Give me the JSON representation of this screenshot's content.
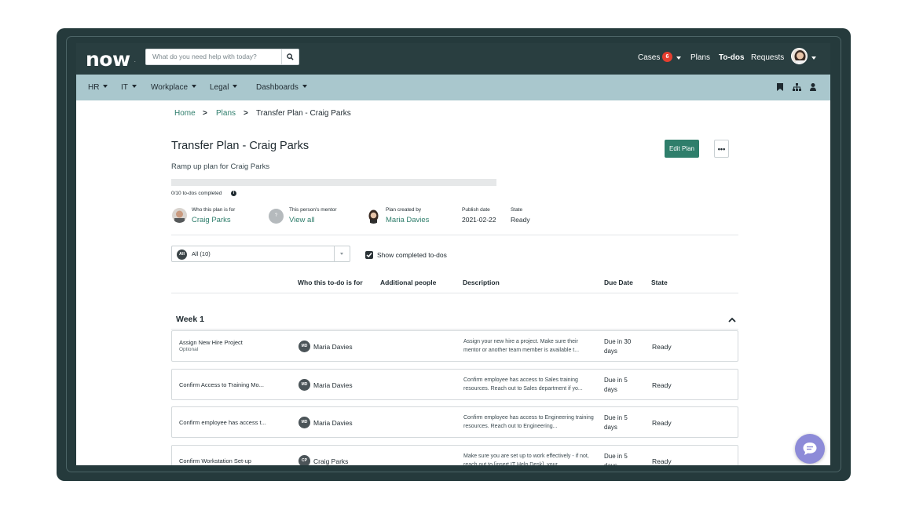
{
  "header": {
    "logo": "now",
    "logo_mark": ".",
    "search_placeholder": "What do you need help with today?",
    "nav": {
      "cases": "Cases",
      "cases_count": "6",
      "plans": "Plans",
      "todos": "To-dos",
      "requests": "Requests"
    }
  },
  "subnav": {
    "items": [
      "HR",
      "IT",
      "Workplace",
      "Legal",
      "Dashboards"
    ]
  },
  "breadcrumb": {
    "home": "Home",
    "plans": "Plans",
    "current": "Transfer Plan - Craig Parks",
    "separator": ">"
  },
  "plan": {
    "title": "Transfer Plan - Craig Parks",
    "subtitle": "Ramp up plan for Craig Parks",
    "edit_label": "Edit Plan",
    "more_label": "•••",
    "progress_text": "0/10 to-dos completed",
    "progress_fraction": 0,
    "info_glyph": "i"
  },
  "meta": {
    "for_label": "Who this plan is for",
    "for_value": "Craig Parks",
    "mentor_label": "This person's mentor",
    "mentor_value": "View all",
    "mentor_initial": "?",
    "created_label": "Plan created by",
    "created_value": "Maria Davies",
    "publish_label": "Publish date",
    "publish_value": "2021-02-22",
    "state_label": "State",
    "state_value": "Ready"
  },
  "filter": {
    "chip": "All",
    "value": "All (10)",
    "show_completed_label": "Show completed to-dos",
    "show_completed": true
  },
  "columns": {
    "who": "Who this to-do is for",
    "additional": "Additional people",
    "description": "Description",
    "due": "Due Date",
    "state": "State"
  },
  "week": {
    "label": "Week 1"
  },
  "rows": [
    {
      "name": "Assign New Hire Project",
      "sub": "Optional",
      "initials": "MD",
      "person": "Maria Davies",
      "desc": "Assign your new hire a project. Make sure their mentor or another team member is available t...",
      "due": "Due in 30 days",
      "state": "Ready"
    },
    {
      "name": "Confirm Access to Training Mo...",
      "sub": "",
      "initials": "MD",
      "person": "Maria Davies",
      "desc": "Confirm employee has access to Sales training resources. Reach out to Sales department if yo...",
      "due": "Due in 5 days",
      "state": "Ready"
    },
    {
      "name": "Confirm employee has access t...",
      "sub": "",
      "initials": "MD",
      "person": "Maria Davies",
      "desc": "Confirm employee has access to Engineering training resources. Reach out to Engineering...",
      "due": "Due in 5 days",
      "state": "Ready"
    },
    {
      "name": "Confirm Workstation Set-up",
      "sub": "",
      "initials": "CP",
      "person": "Craig Parks",
      "desc": "Make sure you are set up to work effectively - if not, reach out to [insert IT Help Desk], your...",
      "due": "Due in 5 days",
      "state": "Ready"
    }
  ],
  "colors": {
    "header_bg": "#293e40",
    "subnav_bg": "#a9c7cd",
    "accent": "#2f7e6b",
    "badge": "#e53e2f",
    "chat": "#8d8bd8"
  },
  "icons": [
    "search-icon",
    "bookmark-icon",
    "org-chart-icon",
    "user-icon",
    "chevron-up-icon",
    "chat-icon",
    "info-icon",
    "check-icon"
  ]
}
